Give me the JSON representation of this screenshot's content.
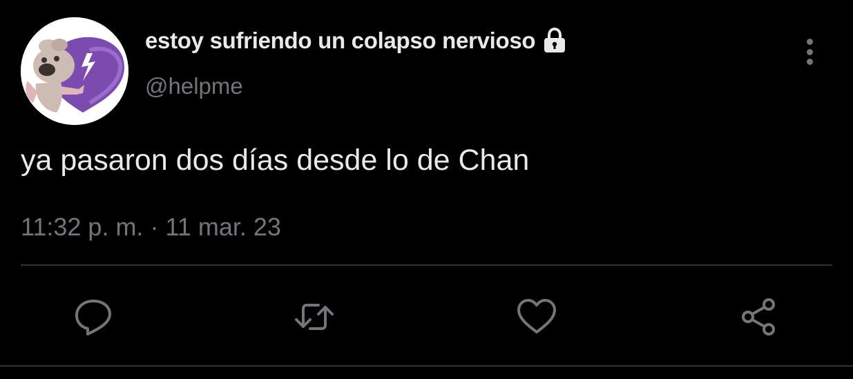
{
  "user": {
    "display_name": "estoy sufriendo un colapso nervioso",
    "handle": "@helpme",
    "avatar_icon": "avatar-heartbroken-character",
    "protected_icon": "lock-icon"
  },
  "tweet": {
    "text": "ya pasaron dos días desde lo de Chan",
    "time": "11:32 p. m.",
    "separator": "·",
    "date": "11 mar. 23"
  },
  "actions": [
    {
      "name": "reply",
      "icon": "reply-icon"
    },
    {
      "name": "retweet",
      "icon": "retweet-icon"
    },
    {
      "name": "like",
      "icon": "heart-icon"
    },
    {
      "name": "share",
      "icon": "share-icon"
    }
  ],
  "colors": {
    "background": "#000000",
    "primary_text": "#e7e9ea",
    "secondary_text": "#71767b",
    "divider": "#2f3336",
    "avatar_heart": "#7b4bb0"
  }
}
